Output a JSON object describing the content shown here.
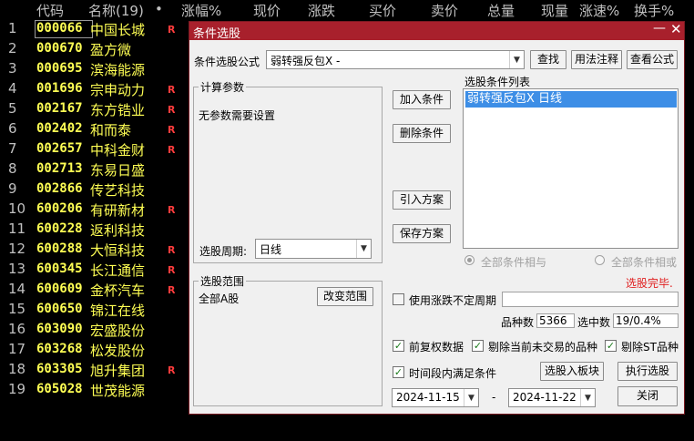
{
  "list": {
    "headers": [
      "代码",
      "名称(19)",
      "•",
      "涨幅%",
      "现价",
      "涨跌",
      "买价",
      "卖价",
      "总量",
      "现量",
      "涨速%",
      "换手%"
    ],
    "rows": [
      {
        "idx": "1",
        "code": "000066",
        "name": "中国长城",
        "r": "R"
      },
      {
        "idx": "2",
        "code": "000670",
        "name": "盈方微",
        "r": ""
      },
      {
        "idx": "3",
        "code": "000695",
        "name": "滨海能源",
        "r": ""
      },
      {
        "idx": "4",
        "code": "001696",
        "name": "宗申动力",
        "r": "R"
      },
      {
        "idx": "5",
        "code": "002167",
        "name": "东方锆业",
        "r": "R"
      },
      {
        "idx": "6",
        "code": "002402",
        "name": "和而泰",
        "r": "R"
      },
      {
        "idx": "7",
        "code": "002657",
        "name": "中科金财",
        "r": "R"
      },
      {
        "idx": "8",
        "code": "002713",
        "name": "东易日盛",
        "r": ""
      },
      {
        "idx": "9",
        "code": "002866",
        "name": "传艺科技",
        "r": ""
      },
      {
        "idx": "10",
        "code": "600206",
        "name": "有研新材",
        "r": "R"
      },
      {
        "idx": "11",
        "code": "600228",
        "name": "返利科技",
        "r": ""
      },
      {
        "idx": "12",
        "code": "600288",
        "name": "大恒科技",
        "r": "R"
      },
      {
        "idx": "13",
        "code": "600345",
        "name": "长江通信",
        "r": "R"
      },
      {
        "idx": "14",
        "code": "600609",
        "name": "金杯汽车",
        "r": "R"
      },
      {
        "idx": "15",
        "code": "600650",
        "name": "锦江在线",
        "r": ""
      },
      {
        "idx": "16",
        "code": "603090",
        "name": "宏盛股份",
        "r": ""
      },
      {
        "idx": "17",
        "code": "603268",
        "name": "松发股份",
        "r": ""
      },
      {
        "idx": "18",
        "code": "603305",
        "name": "旭升集团",
        "r": "R"
      },
      {
        "idx": "19",
        "code": "605028",
        "name": "世茂能源",
        "r": ""
      }
    ]
  },
  "dialog": {
    "title": "条件选股",
    "minimize": "—",
    "close": "✕",
    "formula_label": "条件选股公式",
    "formula_value": "弱转强反包X  -",
    "find_btn": "查找",
    "usage_btn": "用法注释",
    "view_btn": "查看公式",
    "params_caption": "计算参数",
    "params_text": "无参数需要设置",
    "period_label": "选股周期:",
    "period_value": "日线",
    "add_btn": "加入条件",
    "delete_btn": "删除条件",
    "import_btn": "引入方案",
    "save_btn": "保存方案",
    "list_caption": "选股条件列表",
    "list_item": "弱转强反包X  日线",
    "radio_and": "全部条件相与",
    "radio_or": "全部条件相或",
    "status": "选股完毕.",
    "range_caption": "选股范围",
    "range_value": "全部A股",
    "change_range_btn": "改变范围",
    "use_change_label": "使用涨跌不定周期",
    "count_label": "品种数",
    "count_value": "5366",
    "selected_label": "选中数",
    "selected_value": "19/0.4%",
    "prev_adj_label": "前复权数据",
    "remove_untraded_label": "剔除当前未交易的品种",
    "remove_st_label": "剔除ST品种",
    "time_range_label": "时间段内满足条件",
    "to_board_btn": "选股入板块",
    "execute_btn": "执行选股",
    "close_btn": "关闭",
    "date_from": "2024-11-15",
    "date_sep": "-",
    "date_to": "2024-11-22",
    "check_mark": "✓"
  }
}
